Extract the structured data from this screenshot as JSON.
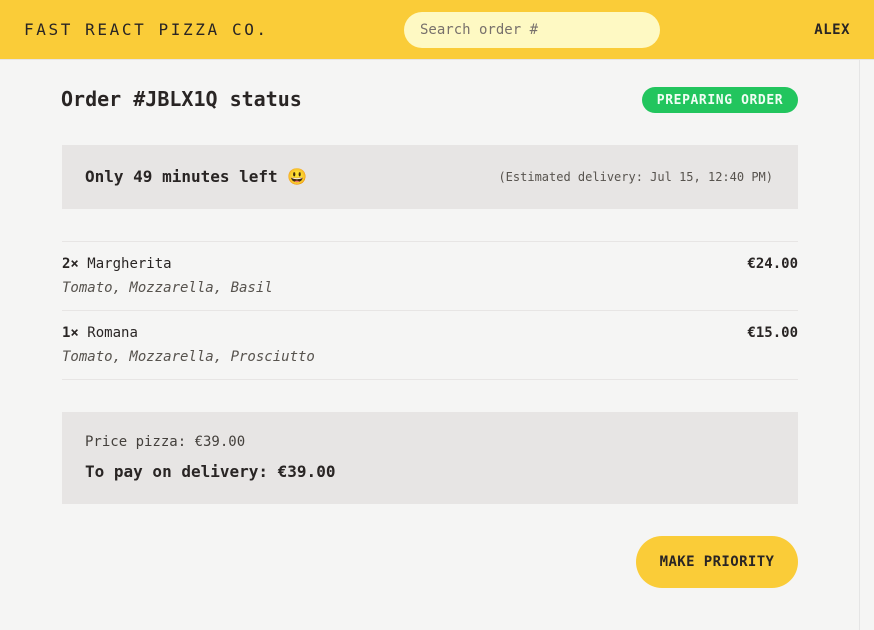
{
  "header": {
    "logo": "FAST REACT PIZZA CO.",
    "search_placeholder": "Search order #",
    "username": "ALEX"
  },
  "order": {
    "title": "Order #JBLX1Q status",
    "status_badge": "PREPARING ORDER",
    "time_left": "Only 49 minutes left 😃",
    "estimated_delivery": "(Estimated delivery: Jul 15, 12:40 PM)",
    "items": [
      {
        "qty": "2×",
        "name": "Margherita",
        "price": "€24.00",
        "ingredients": "Tomato, Mozzarella, Basil"
      },
      {
        "qty": "1×",
        "name": "Romana",
        "price": "€15.00",
        "ingredients": "Tomato, Mozzarella, Prosciutto"
      }
    ],
    "price_pizza": "Price pizza: €39.00",
    "to_pay": "To pay on delivery: €39.00",
    "priority_button": "MAKE PRIORITY"
  },
  "colors": {
    "accent": "#facc38",
    "status_green": "#22c55e",
    "panel": "#e7e5e4"
  }
}
